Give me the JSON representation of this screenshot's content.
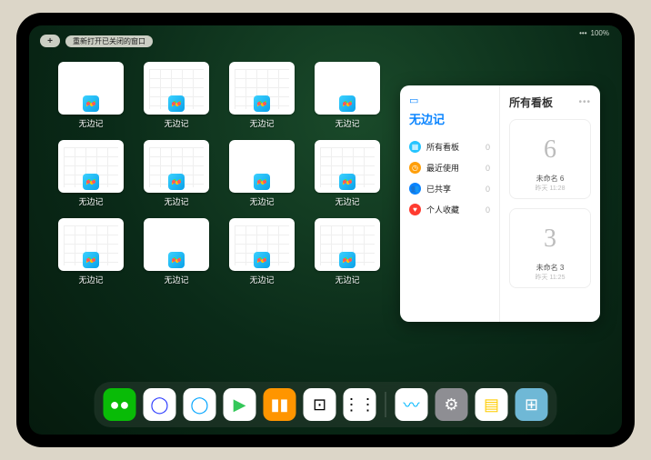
{
  "status": {
    "battery": "100%",
    "signal": "•••"
  },
  "topbar": {
    "plus": "+",
    "reopen": "重新打开已关闭的窗口"
  },
  "appLabel": "无边记",
  "thumbs": [
    {
      "type": "blank"
    },
    {
      "type": "calendar"
    },
    {
      "type": "calendar"
    },
    {
      "type": "blank"
    },
    {
      "type": "calendar"
    },
    {
      "type": "calendar"
    },
    {
      "type": "blank"
    },
    {
      "type": "calendar"
    },
    {
      "type": "calendar"
    },
    {
      "type": "blank"
    },
    {
      "type": "calendar"
    },
    {
      "type": "calendar"
    }
  ],
  "panel": {
    "leftTitle": "无边记",
    "items": [
      {
        "icon": "grid",
        "color": "#25c4ff",
        "label": "所有看板",
        "count": "0"
      },
      {
        "icon": "clock",
        "color": "#ff9f0a",
        "label": "最近使用",
        "count": "0"
      },
      {
        "icon": "people",
        "color": "#0a84ff",
        "label": "已共享",
        "count": "0"
      },
      {
        "icon": "heart",
        "color": "#ff3b30",
        "label": "个人收藏",
        "count": "0"
      }
    ],
    "rightTitle": "所有看板",
    "boards": [
      {
        "sketch": "6",
        "name": "未命名 6",
        "sub": "昨天 11:28"
      },
      {
        "sketch": "3",
        "name": "未命名 3",
        "sub": "昨天 11:25"
      }
    ]
  },
  "dock": [
    {
      "name": "wechat",
      "bg": "#09bb07",
      "glyph": "●●"
    },
    {
      "name": "browser-circle",
      "bg": "#ffffff",
      "glyph": "◯",
      "fg": "#2b3bff"
    },
    {
      "name": "qqbrowser",
      "bg": "#ffffff",
      "glyph": "◯",
      "fg": "#00a4ff"
    },
    {
      "name": "play",
      "bg": "#ffffff",
      "glyph": "▶",
      "fg": "#34c759"
    },
    {
      "name": "books",
      "bg": "#ff9500",
      "glyph": "▮▮"
    },
    {
      "name": "dice",
      "bg": "#ffffff",
      "glyph": "⊡",
      "fg": "#000"
    },
    {
      "name": "dots",
      "bg": "#ffffff",
      "glyph": "⋮⋮",
      "fg": "#000"
    },
    {
      "name": "freeform",
      "bg": "#ffffff",
      "glyph": "〰",
      "fg": "#00b8ff"
    },
    {
      "name": "settings",
      "bg": "#8e8e93",
      "glyph": "⚙"
    },
    {
      "name": "notes",
      "bg": "#ffffff",
      "glyph": "▤",
      "fg": "#ffcc00"
    },
    {
      "name": "appfolder",
      "bg": "#6fb8d6",
      "glyph": "⊞"
    }
  ]
}
